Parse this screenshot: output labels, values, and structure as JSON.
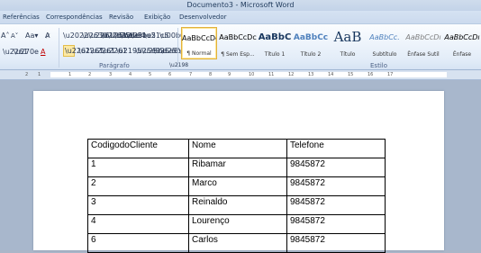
{
  "window": {
    "title": "Documento3 - Microsoft Word"
  },
  "ribbon_tabs": [
    "Referências",
    "Correspondências",
    "Revisão",
    "Exibição",
    "Desenvolvedor"
  ],
  "ribbon": {
    "font_grow": "A˄",
    "font_shrink": "A˅",
    "change_case": "Aa▾",
    "clear_format": "A̷",
    "font_color": "A",
    "group_paragrafo": "Parágrafo",
    "group_estilo": "Estilo",
    "styles": [
      {
        "sample": "AaBbCcDc",
        "name": "¶ Normal"
      },
      {
        "sample": "AaBbCcDc",
        "name": "¶ Sem Esp..."
      },
      {
        "sample": "AaBbC",
        "name": "Título 1"
      },
      {
        "sample": "AaBbCc",
        "name": "Título 2"
      },
      {
        "sample": "AaB",
        "name": "Título"
      },
      {
        "sample": "AaBbCc.",
        "name": "Subtítulo"
      },
      {
        "sample": "AaBbCcDı",
        "name": "Ênfase Sutil"
      },
      {
        "sample": "AaBbCcDı",
        "name": "Ênfase"
      }
    ]
  },
  "ruler": {
    "numbers": [
      "2",
      "1",
      "1",
      "2",
      "3",
      "4",
      "5",
      "6",
      "7",
      "8",
      "9",
      "10",
      "11",
      "12",
      "13",
      "14",
      "15",
      "16",
      "17"
    ]
  },
  "table": {
    "headers": [
      "CodigodoCliente",
      "Nome",
      "Telefone"
    ],
    "rows": [
      [
        "1",
        "Ribamar",
        "9845872"
      ],
      [
        "2",
        "Marco",
        "9845872"
      ],
      [
        "3",
        "Reinaldo",
        "9845872"
      ],
      [
        "4",
        "Lourenço",
        "9845872"
      ],
      [
        "6",
        "Carlos",
        "9845872"
      ]
    ]
  }
}
